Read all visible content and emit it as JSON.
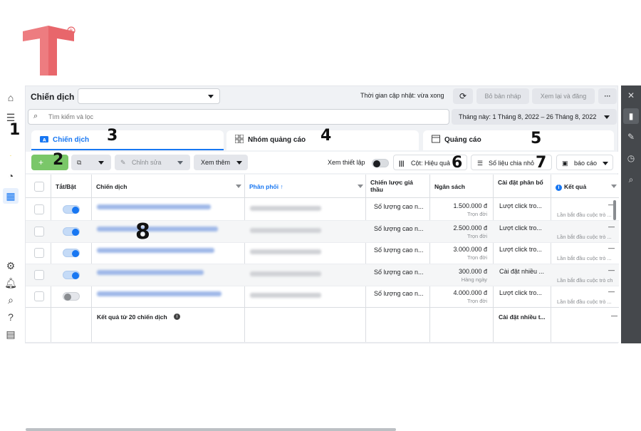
{
  "colors": {
    "accent": "#1877f2",
    "create_green": "#7ac769",
    "logo_red": "#e8666b"
  },
  "callouts": [
    "1",
    "2",
    "3",
    "4",
    "5",
    "6",
    "7",
    "8"
  ],
  "left_rail": [
    "home-icon",
    "menu-icon",
    "apps-icon",
    "dashboard-icon",
    "table-icon",
    "settings-icon",
    "bell-icon",
    "search-icon",
    "help-icon",
    "report-icon"
  ],
  "right_rail": [
    "close-icon",
    "chart-icon",
    "edit-icon",
    "clock-icon",
    "zoom-icon"
  ],
  "topbar": {
    "title": "Chiến dịch",
    "update_time": "Thời gian cập nhật: vừa xong",
    "discard_draft": "Bỏ bản nháp",
    "review_publish": "Xem lại và đăng",
    "more": "···"
  },
  "search": {
    "placeholder": "Tìm kiếm và lọc"
  },
  "date_range": "Tháng này: 1 Tháng 8, 2022 – 26 Tháng 8, 2022",
  "tabs": [
    "Chiến dịch",
    "Nhóm quảng cáo",
    "Quảng cáo"
  ],
  "toolbar": {
    "create": "+",
    "edit": "Chỉnh sửa",
    "view_more": "Xem thêm",
    "view_setup": "Xem thiết lập",
    "columns": "Cột: Hiệu quả",
    "breakdown": "Số liệu chia nhỏ",
    "reports": "báo cáo"
  },
  "table": {
    "headers": [
      "Tắt/Bật",
      "Chiến dịch",
      "Phân phối ↑",
      "Chiến lược giá thầu",
      "Ngân sách",
      "Cài đặt phân bổ",
      "Kết quả"
    ],
    "rows": [
      {
        "on": true,
        "bid": "Số lượng cao n...",
        "budget": "1.500.000 đ",
        "budget_type": "Trọn đời",
        "attribution": "Lượt click tro...",
        "result": "—",
        "result_note": "Lần bắt đầu cuộc trò ..."
      },
      {
        "on": true,
        "bid": "Số lượng cao n...",
        "budget": "2.500.000 đ",
        "budget_type": "Trọn đời",
        "attribution": "Lượt click tro...",
        "result": "—",
        "result_note": "Lần bắt đầu cuộc trò ..."
      },
      {
        "on": true,
        "bid": "Số lượng cao n...",
        "budget": "3.000.000 đ",
        "budget_type": "Trọn đời",
        "attribution": "Lượt click tro...",
        "result": "—",
        "result_note": "Lần bắt đầu cuộc trò ..."
      },
      {
        "on": true,
        "bid": "Số lượng cao n...",
        "budget": "300.000 đ",
        "budget_type": "Hàng ngày",
        "attribution": "Cài đặt nhiều ...",
        "result": "—",
        "result_note": "Lần bắt đầu cuộc trò ch"
      },
      {
        "on": false,
        "bid": "Số lượng cao n...",
        "budget": "4.000.000 đ",
        "budget_type": "Trọn đời",
        "attribution": "Lượt click tro...",
        "result": "—",
        "result_note": "Lần bắt đầu cuộc trò ..."
      }
    ],
    "footer_label": "Kết quả từ 20 chiến dịch",
    "footer_attribution": "Cài đặt nhiều t...",
    "footer_result": "—"
  }
}
